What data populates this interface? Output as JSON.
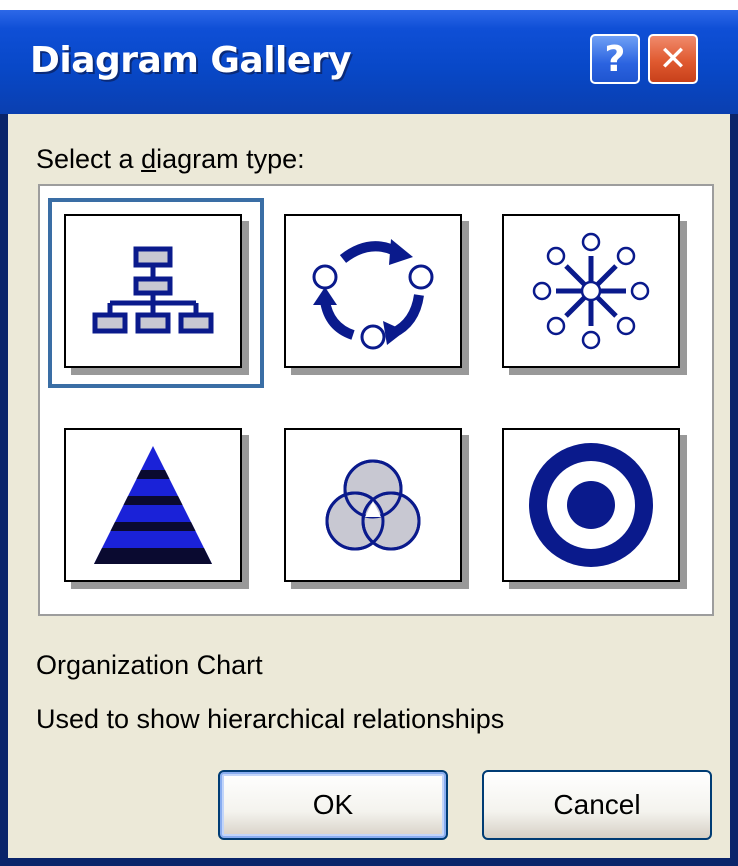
{
  "window": {
    "title": "Diagram Gallery",
    "help_symbol": "?",
    "close_symbol": "✕"
  },
  "prompt": {
    "before": "Select a ",
    "mnemonic": "d",
    "after": "iagram type:"
  },
  "gallery": {
    "selected_index": 0,
    "items": [
      {
        "icon": "organization-chart-icon"
      },
      {
        "icon": "cycle-diagram-icon"
      },
      {
        "icon": "radial-diagram-icon"
      },
      {
        "icon": "pyramid-diagram-icon"
      },
      {
        "icon": "venn-diagram-icon"
      },
      {
        "icon": "target-diagram-icon"
      }
    ]
  },
  "description": {
    "name": "Organization Chart",
    "text": "Used to show hierarchical relationships"
  },
  "buttons": {
    "ok_label": "OK",
    "cancel_label": "Cancel"
  },
  "colors": {
    "accent": "#0a1a8c",
    "fill_gray": "#c8c8d2",
    "selection": "#3a6ea5",
    "titlebar": "#0848c8"
  }
}
